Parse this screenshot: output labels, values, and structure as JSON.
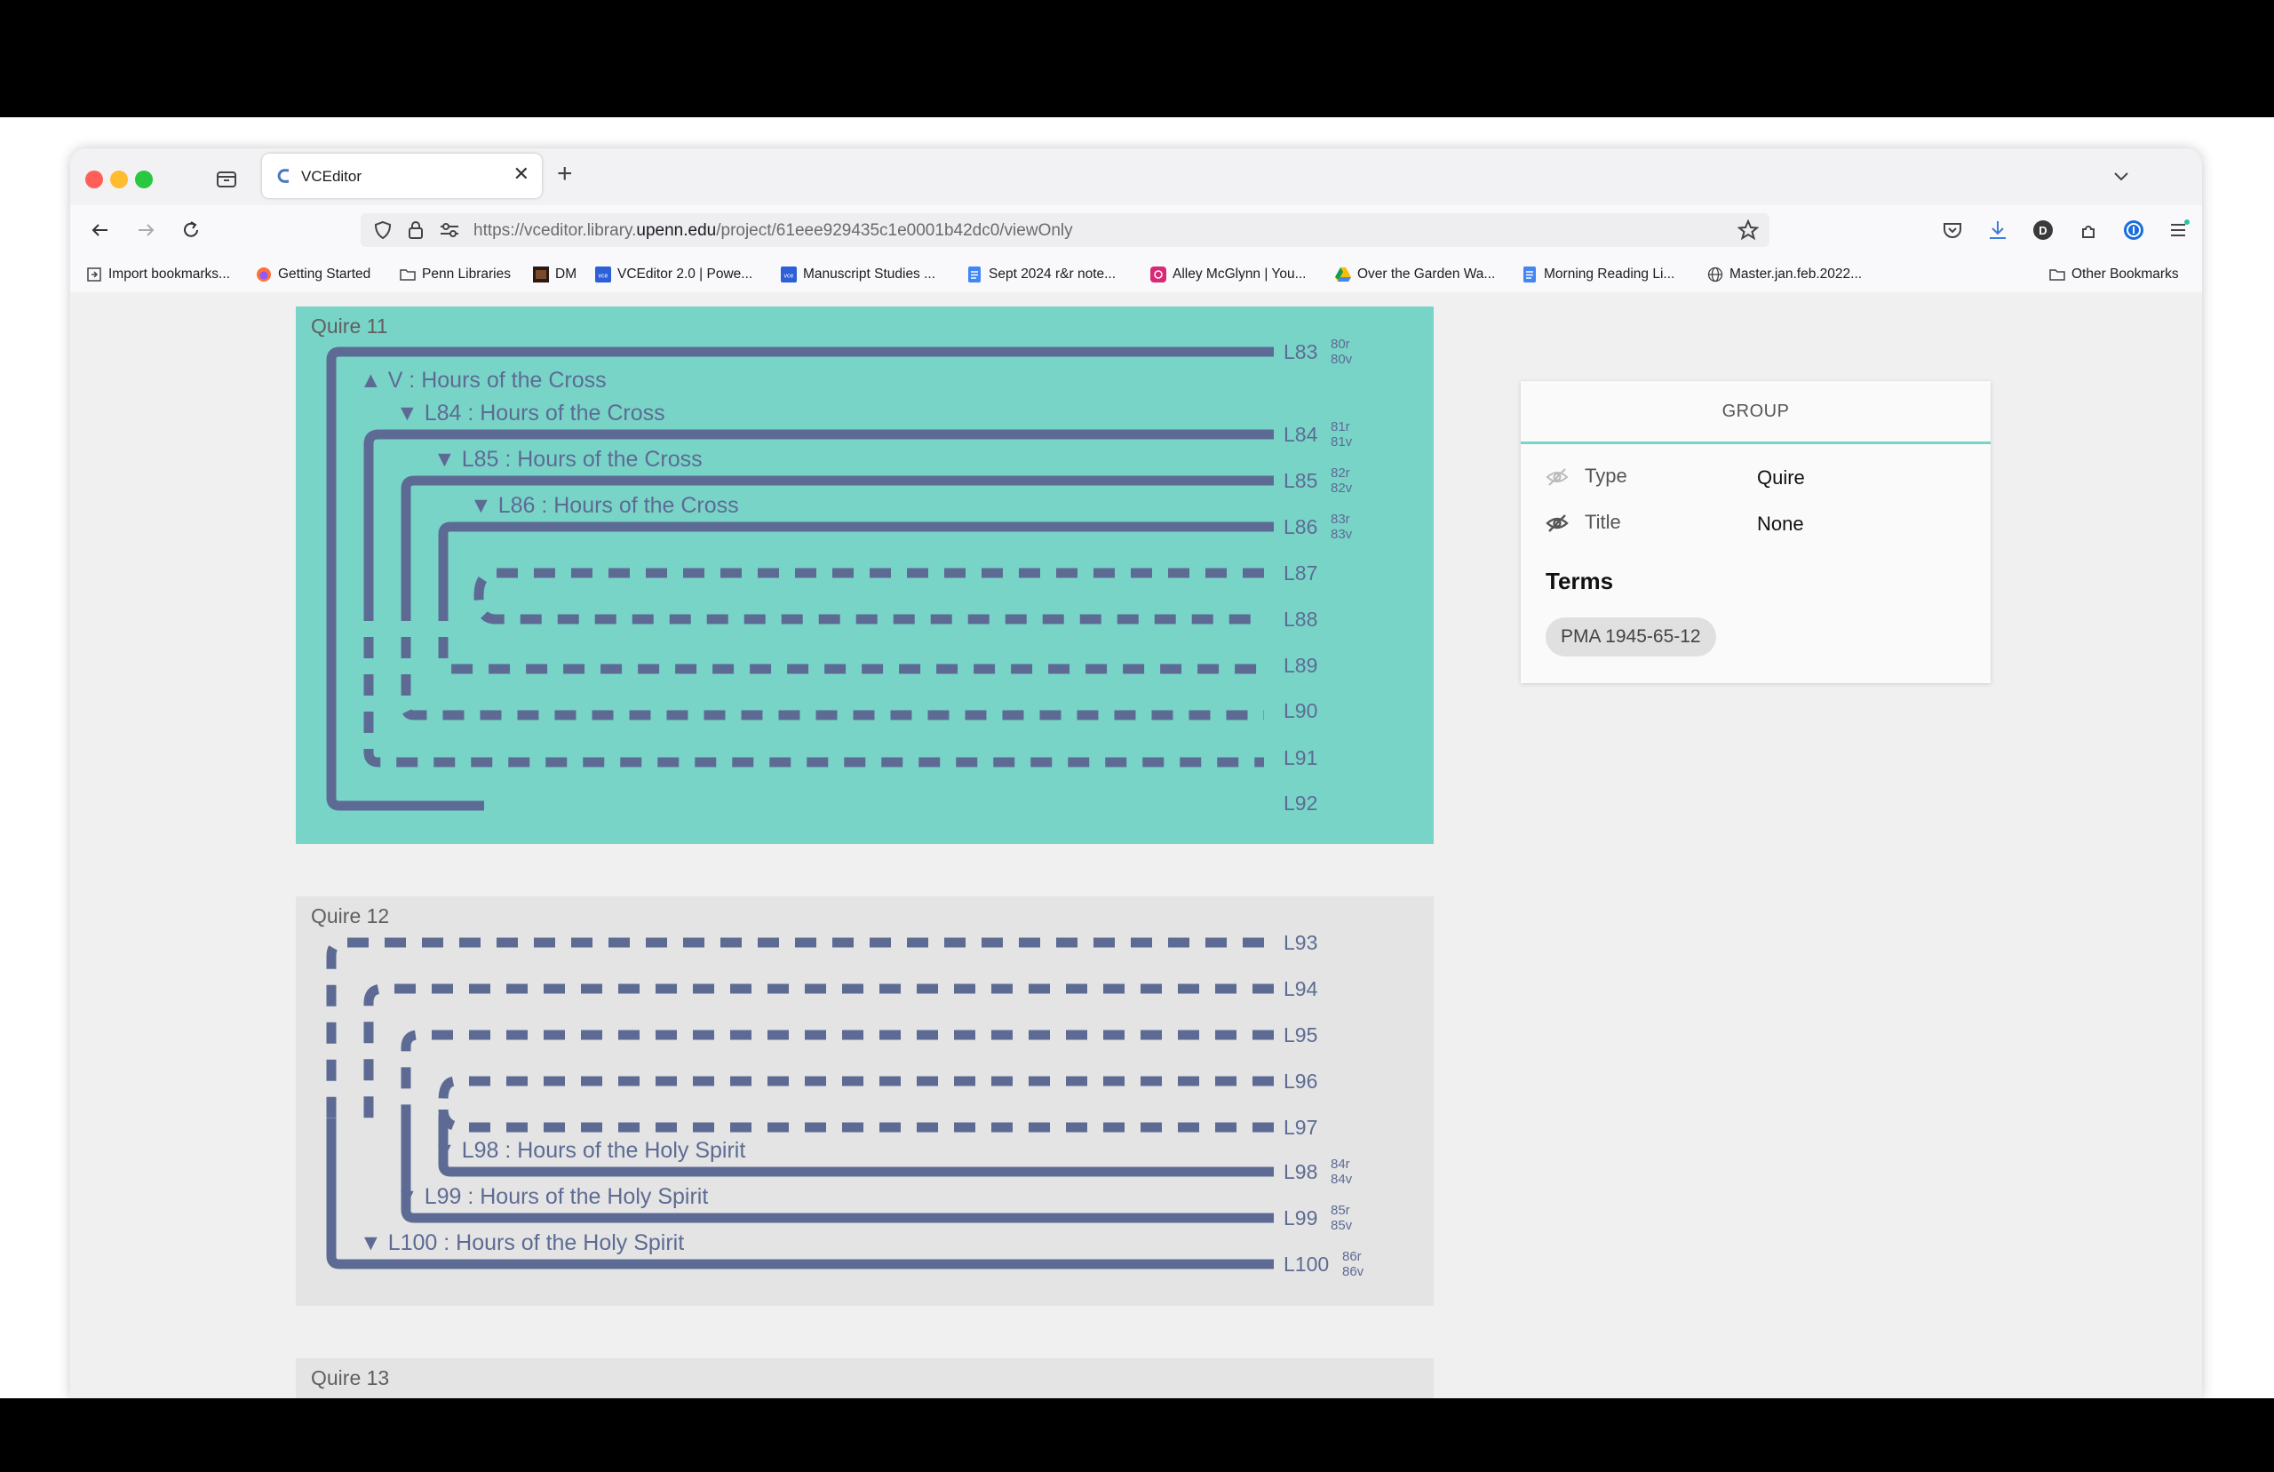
{
  "browser": {
    "tab_title": "VCEditor",
    "url_prefix": "https://vceditor.library.",
    "url_domain": "upenn.edu",
    "url_path": "/project/61eee929435c1e0001b42dc0/viewOnly",
    "bookmarks": [
      {
        "label": "Import bookmarks...",
        "icon": "import-icon"
      },
      {
        "label": "Getting Started",
        "icon": "firefox-icon"
      },
      {
        "label": "Penn Libraries",
        "icon": "folder-icon"
      },
      {
        "label": "DM",
        "icon": "dm-favicon"
      },
      {
        "label": "VCEditor 2.0 | Powe...",
        "icon": "vce-favicon"
      },
      {
        "label": "Manuscript Studies ...",
        "icon": "vce-favicon"
      },
      {
        "label": "Sept 2024 r&r note...",
        "icon": "docs-icon"
      },
      {
        "label": "Alley McGlynn | You...",
        "icon": "instagram-icon"
      },
      {
        "label": "Over the Garden Wa...",
        "icon": "drive-icon"
      },
      {
        "label": "Morning Reading Li...",
        "icon": "docs-icon"
      },
      {
        "label": "Master.jan.feb.2022...",
        "icon": "globe-icon"
      }
    ],
    "other_bookmarks": "Other Bookmarks"
  },
  "quires": [
    {
      "label": "Quire 11",
      "leaves": [
        {
          "name": "L83",
          "folios": [
            "80r",
            "80v"
          ]
        },
        {
          "name": "L84",
          "folios": [
            "81r",
            "81v"
          ]
        },
        {
          "name": "L85",
          "folios": [
            "82r",
            "82v"
          ]
        },
        {
          "name": "L86",
          "folios": [
            "83r",
            "83v"
          ]
        },
        {
          "name": "L87"
        },
        {
          "name": "L88"
        },
        {
          "name": "L89"
        },
        {
          "name": "L90"
        },
        {
          "name": "L91"
        },
        {
          "name": "L92"
        }
      ],
      "groups": [
        "▲ V : Hours of the Cross",
        "▼ L84 : Hours of the Cross",
        "▼ L85 : Hours of the Cross",
        "▼ L86 : Hours of the Cross"
      ]
    },
    {
      "label": "Quire 12",
      "leaves": [
        {
          "name": "L93"
        },
        {
          "name": "L94"
        },
        {
          "name": "L95"
        },
        {
          "name": "L96"
        },
        {
          "name": "L97"
        },
        {
          "name": "L98",
          "folios": [
            "84r",
            "84v"
          ]
        },
        {
          "name": "L99",
          "folios": [
            "85r",
            "85v"
          ]
        },
        {
          "name": "L100",
          "folios": [
            "86r",
            "86v"
          ]
        }
      ],
      "groups": [
        "▼ L98 : Hours of the Holy Spirit",
        "▼ L99 : Hours of the Holy Spirit",
        "▼ L100 : Hours of the Holy Spirit"
      ]
    },
    {
      "label": "Quire 13"
    }
  ],
  "panel": {
    "header": "GROUP",
    "type_label": "Type",
    "type_value": "Quire",
    "title_label": "Title",
    "title_value": "None",
    "terms_heading": "Terms",
    "term": "PMA 1945-65-12"
  },
  "colors": {
    "quire_active": "#79d4c8",
    "quire_inactive": "#e4e4e4",
    "leaf": "#5d6b94",
    "panel_accent": "#79d4c8"
  }
}
